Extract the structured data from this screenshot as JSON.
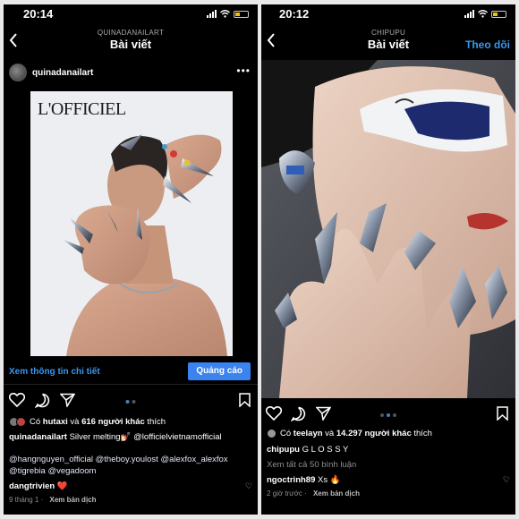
{
  "left": {
    "status": {
      "time": "20:14"
    },
    "nav": {
      "subtitle": "QUINADANAILART",
      "title": "Bài viết",
      "back_icon": "chevron-left-icon"
    },
    "post": {
      "username": "quinadanailart",
      "more_icon": "more-horizontal-icon",
      "image": {
        "magazine": "L'OFFICIEL",
        "subject": "model with chrome silver nail art"
      },
      "cta": {
        "link": "Xem thông tin chi tiết",
        "button": "Quảng cáo"
      },
      "likes": {
        "prefix": "Có ",
        "user": "hutaxi",
        "middle": " và ",
        "count": "616 người khác",
        "suffix": " thích"
      },
      "caption": {
        "user": "quinadanailart",
        "text": " Silver melting💅🏻 @lofficielvietnamofficial",
        "tags_line1": "@hangnguyen_official @theboy.youlost @alexfox_alexfox",
        "tags_line2": "@tigrebia @vegadoom"
      },
      "comment": {
        "user": "dangtrivien",
        "text": " ❤️"
      },
      "meta": {
        "time": "9 tháng 1 · ",
        "translate": "Xem bản dịch"
      }
    }
  },
  "right": {
    "status": {
      "time": "20:12"
    },
    "nav": {
      "subtitle": "CHIPUPU",
      "title": "Bài viết",
      "follow": "Theo dõi",
      "back_icon": "chevron-left-icon"
    },
    "post": {
      "image": {
        "subject": "model with white visor sunglasses and silver nail art"
      },
      "likes": {
        "prefix": "Có ",
        "user": "teelayn",
        "middle": " và ",
        "count": "14.297 người khác",
        "suffix": " thích"
      },
      "caption": {
        "user": "chipupu",
        "text": " G L O S S Y"
      },
      "view_all": "Xem tất cả 50 bình luận",
      "comment": {
        "user": "ngoctrinh89",
        "text": " Xs 🔥"
      },
      "meta": {
        "time": "2 giờ trước · ",
        "translate": "Xem bản dịch"
      }
    }
  },
  "colors": {
    "accent": "#3897f0",
    "button": "#3b83ee",
    "bg": "#000000",
    "muted": "#8e8e8e"
  },
  "icons": [
    "heart-icon",
    "comment-icon",
    "share-icon",
    "bookmark-icon"
  ]
}
